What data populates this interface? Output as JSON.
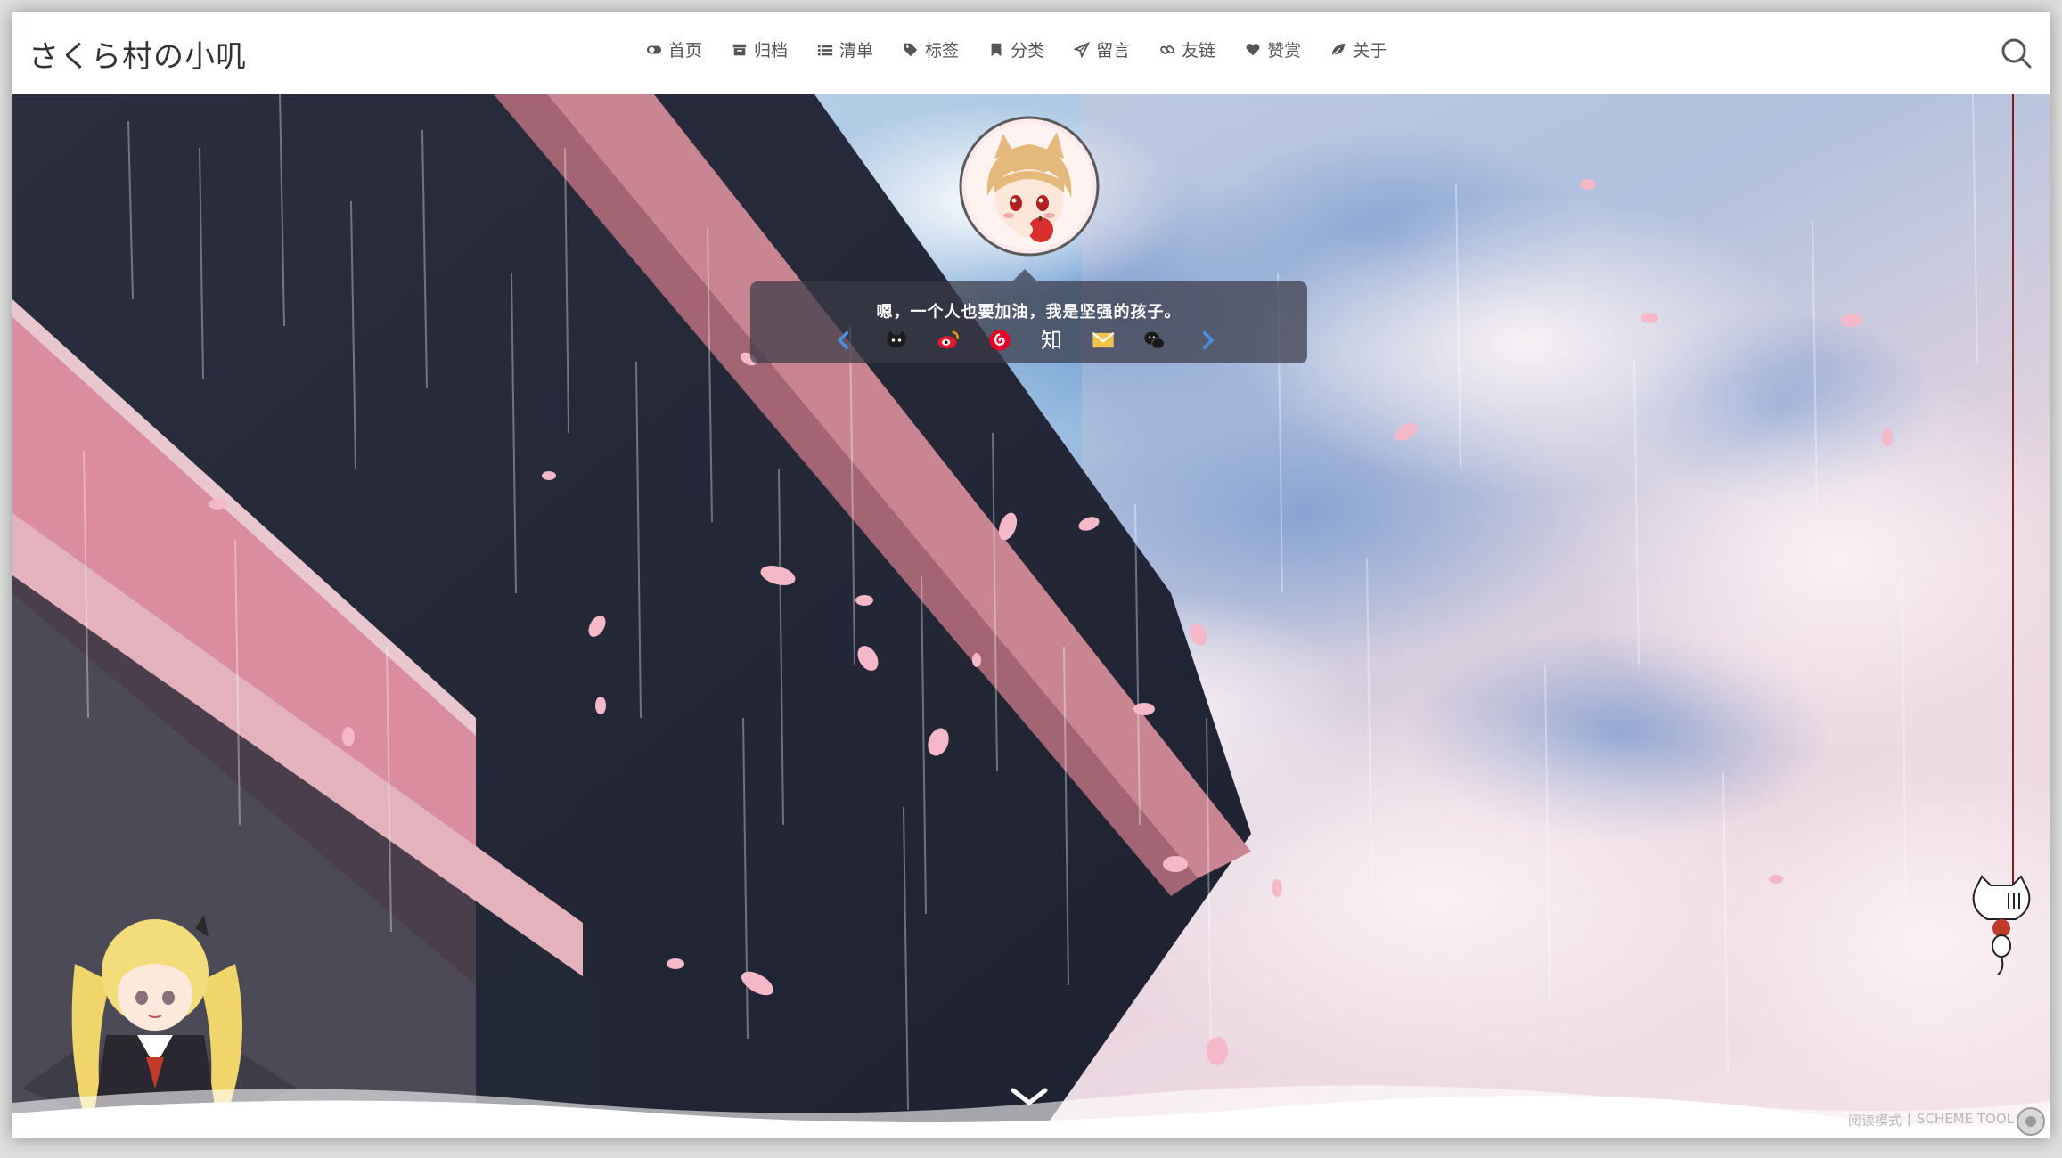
{
  "site": {
    "title": "さくら村の小叽"
  },
  "nav": {
    "items": [
      {
        "label": "首页",
        "icon": "toggle-icon"
      },
      {
        "label": "归档",
        "icon": "archive-icon"
      },
      {
        "label": "清单",
        "icon": "list-icon"
      },
      {
        "label": "标签",
        "icon": "tag-icon"
      },
      {
        "label": "分类",
        "icon": "bookmark-icon"
      },
      {
        "label": "留言",
        "icon": "paper-plane-icon"
      },
      {
        "label": "友链",
        "icon": "link-icon"
      },
      {
        "label": "赞赏",
        "icon": "heart-icon"
      },
      {
        "label": "关于",
        "icon": "leaf-icon"
      }
    ]
  },
  "hero": {
    "motto": "嗯，一个人也要加油，我是坚强的孩子。",
    "zhihu_glyph": "知",
    "social_icons": [
      "prev-arrow-icon",
      "github-icon",
      "weibo-icon",
      "netease-music-icon",
      "zhihu-icon",
      "email-icon",
      "wechat-icon",
      "next-arrow-icon"
    ]
  },
  "footer": {
    "reading_mode": "阅读模式",
    "separator": "|",
    "scheme_tool": "SCHEME TOOL"
  },
  "colors": {
    "accent_blue": "#4a90e2",
    "header_bg": "#ffffff",
    "card_bg": "rgba(58,58,70,0.72)",
    "petal": "#f5b8c8",
    "rope": "#7a1e1e"
  }
}
